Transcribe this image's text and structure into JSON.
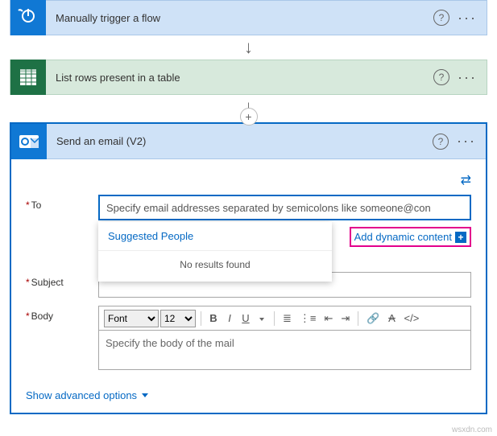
{
  "steps": {
    "manual": {
      "label": "Manually trigger a flow"
    },
    "excel": {
      "label": "List rows present in a table"
    },
    "email": {
      "title": "Send an email (V2)"
    }
  },
  "form": {
    "to": {
      "label": "To",
      "placeholder": "Specify email addresses separated by semicolons like someone@con"
    },
    "subject": {
      "label": "Subject"
    },
    "body": {
      "label": "Body",
      "placeholder": "Specify the body of the mail"
    }
  },
  "toolbar": {
    "font_label": "Font",
    "size_label": "12"
  },
  "suggested": {
    "title": "Suggested People",
    "noresults": "No results found"
  },
  "dynamic": {
    "label": "Add dynamic content"
  },
  "advanced": {
    "label": "Show advanced options"
  },
  "watermark": "wsxdn.com"
}
